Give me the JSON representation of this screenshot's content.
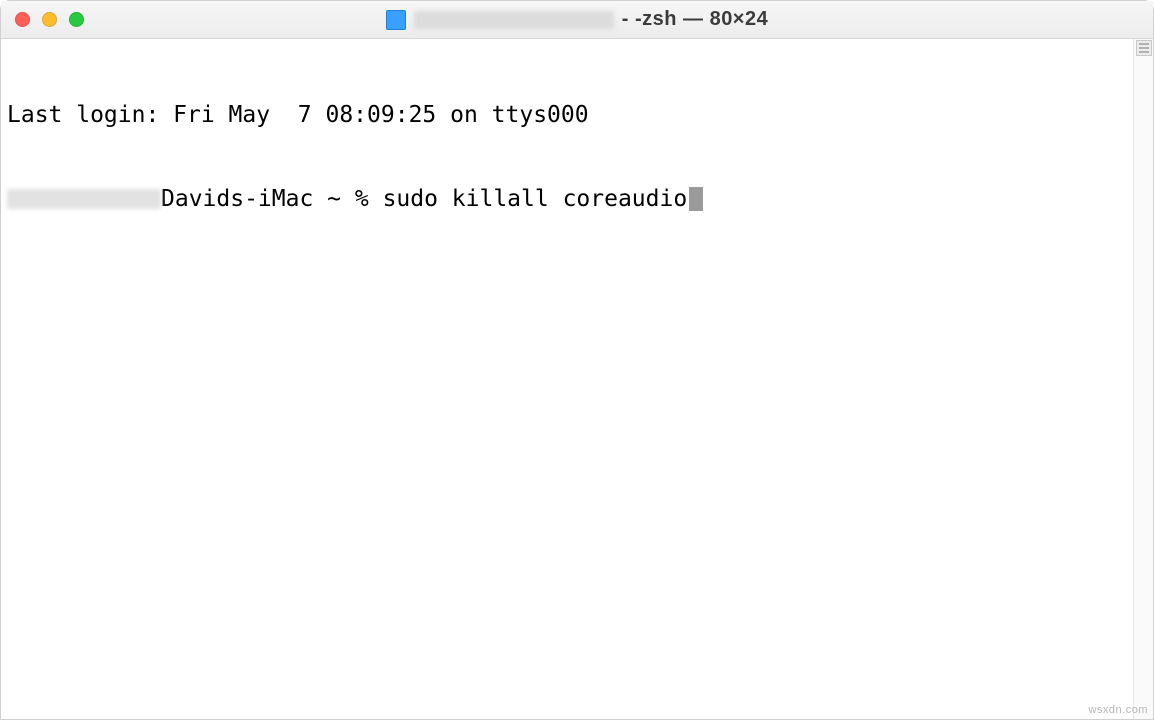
{
  "titlebar": {
    "title_suffix": "- -zsh — 80×24"
  },
  "terminal": {
    "last_login": "Last login: Fri May  7 08:09:25 on ttys000",
    "prompt_host": "Davids-iMac ~ % ",
    "command": "sudo killall coreaudio"
  },
  "watermark": "wsxdn.com"
}
